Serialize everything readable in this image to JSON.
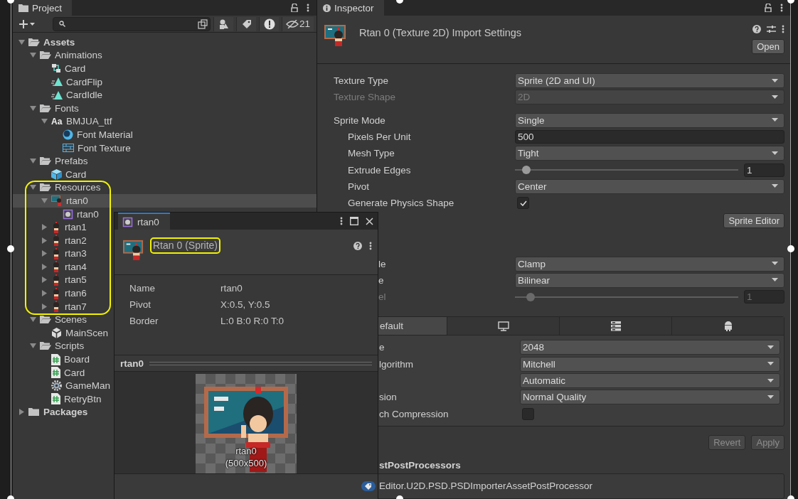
{
  "project": {
    "tab": "Project",
    "hidden_count": "21",
    "tree": [
      {
        "label": "Assets",
        "kind": "folder",
        "expanded": true,
        "selected": false,
        "children": [
          {
            "label": "Animations",
            "kind": "folder",
            "expanded": true,
            "selected": false,
            "children": [
              {
                "label": "Card",
                "kind": "animator",
                "selected": false
              },
              {
                "label": "CardFlip",
                "kind": "animation",
                "selected": false
              },
              {
                "label": "CardIdle",
                "kind": "animation",
                "selected": false
              }
            ]
          },
          {
            "label": "Fonts",
            "kind": "folder",
            "expanded": true,
            "selected": false,
            "children": [
              {
                "label": "BMJUA_ttf",
                "kind": "font",
                "icon_text": "Aa",
                "expanded": true,
                "selected": false,
                "children": [
                  {
                    "label": "Font Material",
                    "kind": "material",
                    "selected": false
                  },
                  {
                    "label": "Font Texture",
                    "kind": "texture",
                    "selected": false
                  }
                ]
              }
            ]
          },
          {
            "label": "Prefabs",
            "kind": "folder",
            "expanded": true,
            "selected": false,
            "children": [
              {
                "label": "Card",
                "kind": "prefab",
                "selected": false
              }
            ]
          },
          {
            "label": "Resources",
            "kind": "folder",
            "expanded": true,
            "selected": false,
            "children": [
              {
                "label": "rtan0",
                "kind": "sprite_sheet",
                "expanded": true,
                "selected": true,
                "children": [
                  {
                    "label": "rtan0",
                    "kind": "sprite",
                    "selected": false
                  }
                ]
              },
              {
                "label": "rtan1",
                "kind": "character",
                "expanded": false,
                "selected": false
              },
              {
                "label": "rtan2",
                "kind": "character",
                "expanded": false,
                "selected": false
              },
              {
                "label": "rtan3",
                "kind": "character",
                "expanded": false,
                "selected": false
              },
              {
                "label": "rtan4",
                "kind": "character",
                "expanded": false,
                "selected": false
              },
              {
                "label": "rtan5",
                "kind": "character",
                "expanded": false,
                "selected": false
              },
              {
                "label": "rtan6",
                "kind": "character",
                "expanded": false,
                "selected": false
              },
              {
                "label": "rtan7",
                "kind": "character",
                "expanded": false,
                "selected": false
              }
            ]
          },
          {
            "label": "Scenes",
            "kind": "folder",
            "expanded": true,
            "selected": false,
            "children": [
              {
                "label": "MainScen",
                "kind": "scene",
                "selected": false
              }
            ]
          },
          {
            "label": "Scripts",
            "kind": "folder",
            "expanded": true,
            "selected": false,
            "children": [
              {
                "label": "Board",
                "kind": "script",
                "selected": false
              },
              {
                "label": "Card",
                "kind": "script",
                "selected": false
              },
              {
                "label": "GameMan",
                "kind": "gear",
                "selected": false
              },
              {
                "label": "RetryBtn",
                "kind": "script",
                "selected": false
              }
            ]
          }
        ]
      },
      {
        "label": "Packages",
        "kind": "folder",
        "expanded": false,
        "selected": false
      }
    ]
  },
  "inspector": {
    "tab": "Inspector",
    "title": "Rtan 0 (Texture 2D) Import Settings",
    "open_button": "Open",
    "settings_groups": [
      [
        {
          "label": "Texture Type",
          "kind": "dropdown",
          "value": "Sprite (2D and UI)",
          "disabled": false
        },
        {
          "label": "Texture Shape",
          "kind": "dropdown",
          "value": "2D",
          "disabled": true
        }
      ],
      [
        {
          "label": "Sprite Mode",
          "kind": "dropdown",
          "value": "Single",
          "disabled": false,
          "children": [
            {
              "label": "Pixels Per Unit",
              "kind": "input",
              "value": "500",
              "disabled": false
            },
            {
              "label": "Mesh Type",
              "kind": "dropdown",
              "value": "Tight",
              "disabled": false
            },
            {
              "label": "Extrude Edges",
              "kind": "slider",
              "level": 0.05,
              "value": "1",
              "disabled": false
            },
            {
              "label": "Pivot",
              "kind": "dropdown",
              "value": "Center",
              "disabled": false
            },
            {
              "label": "Generate Physics Shape",
              "kind": "checkbox",
              "checked": true,
              "disabled": false
            }
          ]
        }
      ]
    ],
    "sprite_editor_button": "Sprite Editor",
    "partial_settings": [
      {
        "label": "le",
        "kind": "dropdown",
        "value": "Clamp",
        "disabled": false
      },
      {
        "label": "e",
        "kind": "dropdown",
        "value": "Bilinear",
        "disabled": false
      },
      {
        "label": "el",
        "kind": "slider",
        "level": 0.07,
        "value": "1",
        "disabled": true
      }
    ],
    "platform_tabs": [
      {
        "kind": "text",
        "label": "efault",
        "selected": true
      },
      {
        "kind": "monitor",
        "selected": false
      },
      {
        "kind": "server",
        "selected": false
      },
      {
        "kind": "android",
        "selected": false
      }
    ],
    "platform_settings": [
      {
        "label": "e",
        "kind": "dropdown",
        "value": "2048",
        "disabled": false
      },
      {
        "label": "lgorithm",
        "kind": "dropdown",
        "value": "Mitchell",
        "disabled": false
      },
      {
        "kind": "dropdown",
        "value": "Automatic",
        "disabled": false
      },
      {
        "label": "sion",
        "kind": "dropdown",
        "value": "Normal Quality",
        "disabled": false
      },
      {
        "label": "ch Compression",
        "kind": "checkbox",
        "checked": false,
        "disabled": false
      }
    ],
    "buttons": [
      {
        "label": "Revert",
        "disabled": true
      },
      {
        "label": "Apply",
        "disabled": true
      }
    ],
    "postprocessors_heading": "stPostProcessors",
    "postprocessor": "Editor.U2D.PSD.PSDImporterAssetPostProcessor"
  },
  "sprite_window": {
    "tab": "rtan0",
    "title": "Rtan 0 (Sprite)",
    "properties": [
      {
        "name": "Name",
        "value": "rtan0"
      },
      {
        "name": "Pivot",
        "value": "X:0.5, Y:0.5"
      },
      {
        "name": "Border",
        "value": "L:0 B:0 R:0 T:0"
      }
    ],
    "preview_title": "rtan0",
    "preview_caption": [
      "rtan0",
      "(500x500)"
    ]
  }
}
